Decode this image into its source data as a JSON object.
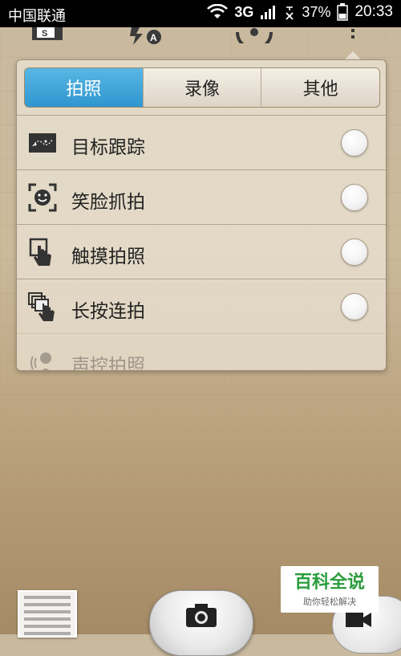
{
  "status_bar": {
    "carrier": "中国联通",
    "network": "3G",
    "battery_percent": "37%",
    "time": "20:33"
  },
  "toolbar": {
    "icons": [
      "scene-mode-icon",
      "flash-auto-icon",
      "switch-camera-icon",
      "more-menu-icon"
    ]
  },
  "tabs": [
    {
      "label": "拍照",
      "active": true
    },
    {
      "label": "录像",
      "active": false
    },
    {
      "label": "其他",
      "active": false
    }
  ],
  "rows": [
    {
      "label": "目标跟踪",
      "icon": "object-tracking-icon",
      "checked": false
    },
    {
      "label": "笑脸抓拍",
      "icon": "smile-detect-icon",
      "checked": false
    },
    {
      "label": "触摸拍照",
      "icon": "touch-shoot-icon",
      "checked": false
    },
    {
      "label": "长按连拍",
      "icon": "burst-shoot-icon",
      "checked": false
    },
    {
      "label": "声控拍照",
      "icon": "voice-shoot-icon",
      "checked": false
    }
  ],
  "watermark": {
    "title": "百科全说",
    "subtitle": "助你轻松解决"
  },
  "colors": {
    "active_tab": "#2f96cf",
    "watermark_green": "#2a9c3c"
  }
}
